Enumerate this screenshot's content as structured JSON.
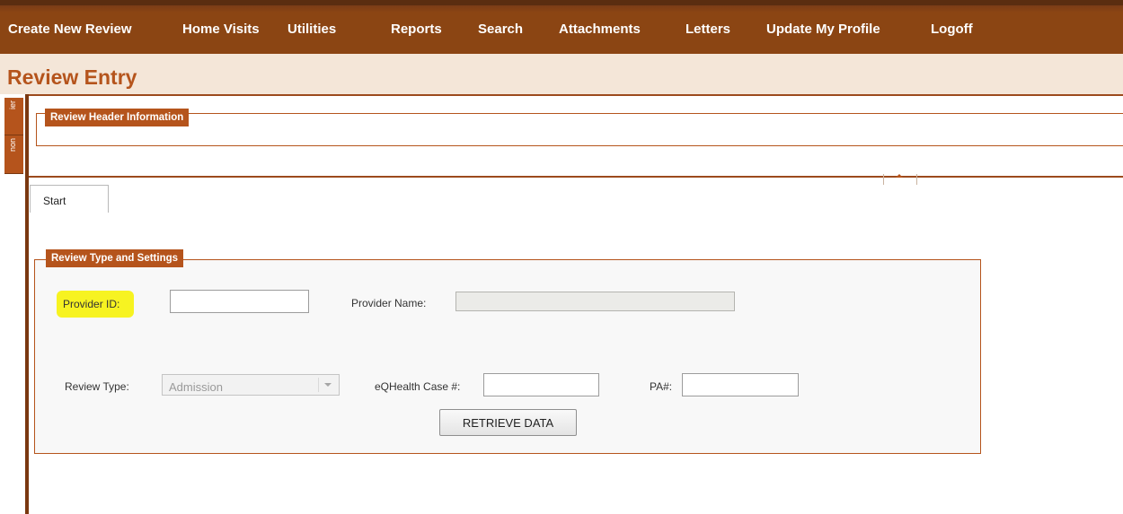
{
  "nav": {
    "items": [
      {
        "label": "Create New Review"
      },
      {
        "label": "Home Visits"
      },
      {
        "label": "Utilities"
      },
      {
        "label": "Reports"
      },
      {
        "label": "Search"
      },
      {
        "label": "Attachments"
      },
      {
        "label": "Letters"
      },
      {
        "label": "Update My Profile"
      },
      {
        "label": "Logoff"
      }
    ]
  },
  "page": {
    "title": "Review Entry"
  },
  "side_tabs": [
    {
      "label": "ier"
    },
    {
      "label": "non"
    }
  ],
  "header": {
    "legend": "Review Header Information"
  },
  "tabs": [
    {
      "label": "Start"
    }
  ],
  "settings": {
    "legend": "Review Type and Settings",
    "provider_id_label": "Provider ID:",
    "provider_id_value": "",
    "provider_name_label": "Provider Name:",
    "provider_name_value": "",
    "review_type_label": "Review Type:",
    "review_type_value": "Admission",
    "case_label": "eQHealth Case #:",
    "case_value": "",
    "pa_label": "PA#:",
    "pa_value": "",
    "retrieve_button": "RETRIEVE DATA"
  },
  "colors": {
    "nav_bg": "#8b4513",
    "accent": "#b5541c",
    "title_strip": "#f4e6d8",
    "highlight": "#f7f321"
  }
}
